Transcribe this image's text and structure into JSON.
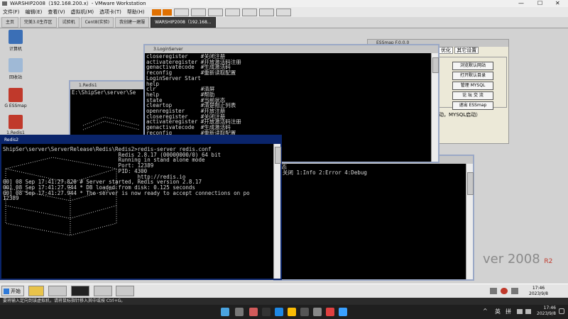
{
  "vmware": {
    "title": "WARSHIP2008（192.168.200.x）- VMware Workstation",
    "menu": [
      "文件(F)",
      "编辑(E)",
      "查看(V)",
      "虚拟机(M)",
      "选项卡(T)",
      "帮助(H)"
    ],
    "tabs": [
      "主页",
      "完美3.0生存区",
      "试验机",
      "Cent8(实验)",
      "我创建一建服",
      "WARSHIP2008（192.168..."
    ],
    "status_text": "要将输入定向到该虚拟机，请将鼠标指针移入其中或按 Ctrl+G。"
  },
  "desktop": {
    "icons": [
      "计算机",
      "回收站",
      "G ESSmap",
      "1.Redis1"
    ],
    "os_brand": "ver 2008",
    "os_suffix": "R2"
  },
  "windows": {
    "login": {
      "title": "3.LoginServer",
      "lines": [
        "closeregister    #关闭注册",
        "activateregister #开放激活码注册",
        "genactivatecode  #生成激活码",
        "reconfig         #重新读取配置",
        "LoginServer Start",
        "help",
        "clr              #清屏",
        "help             #帮助",
        "state            #当前状态",
        "cleartop         #清楚阻止列表",
        "openregister     #开放注册",
        "closeregister    #关闭注册",
        "activateregister #开放激活码注册",
        "genactivatecode  #生成激活码",
        "reconfig         #重新读取配置"
      ]
    },
    "redis1": {
      "title": "1.Redis1",
      "lines": [
        "",
        "E:\\ShipSer\\server\\Se"
      ]
    },
    "redis2": {
      "title": "Redis2",
      "lines": [
        "ShipSer\\server\\ServerRelease\\Redis\\Redis2>redis-server redis.conf",
        "",
        "",
        "                                    Redis 2.8.17 (00000000/0) 64 bit",
        "",
        "                                    Running in stand alone mode",
        "                                    Port: 12389",
        "                                    PID: 4300",
        "",
        "",
        "                                          http://redis.io",
        "",
        "",
        "",
        "",
        "",
        "",
        "",
        "00] 08 Sep 17:41:27.820 # Server started, Redis version 2.8.17",
        "00] 08 Sep 17:41:27.944 * DB loaded from disk: 0.125 seconds",
        "00] 08 Sep 17:41:27.944 * The server is now ready to accept connections on po",
        "12389"
      ]
    },
    "gamelog": {
      "lines": [
        "状态",
        "",
        "0:关闭 1:Info 2:Error 4:Debug"
      ]
    },
    "ess": {
      "title": "ESSmap F.0.0.0",
      "tabs": [
        "优化",
        "其它设置"
      ],
      "buttons": [
        "浏览默认网站",
        "打开默认目录",
        "管理 MYSQL",
        "论 坛 交 流",
        "退出 ESSmap"
      ],
      "status": "动，MYSQL启动）"
    }
  },
  "guest_taskbar": {
    "start_label": "开始",
    "time": "17:46",
    "date": "2023/9/8"
  },
  "host_taskbar": {
    "lang": "英",
    "ime": "拼",
    "time": "17:46",
    "date": "2023/9/8"
  }
}
